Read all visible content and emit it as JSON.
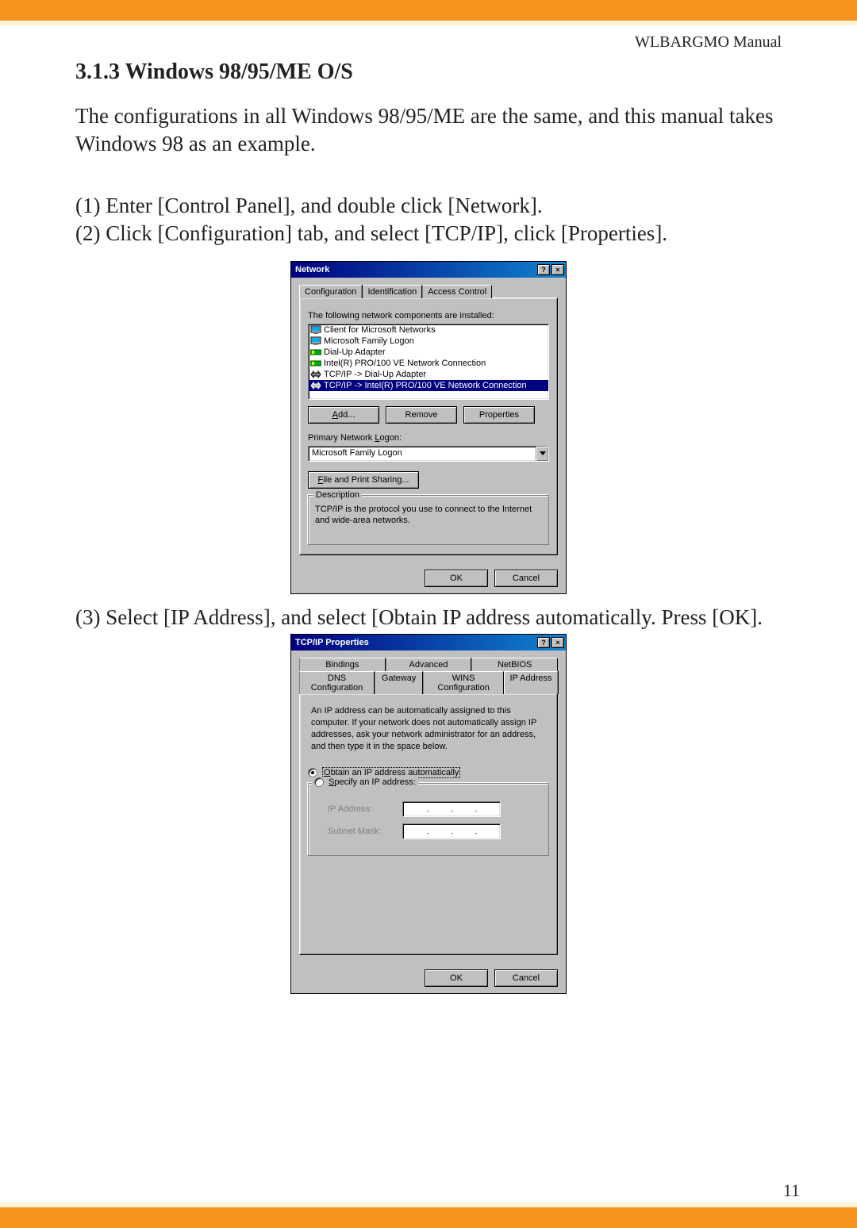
{
  "header": {
    "manual": "WLBARGMO Manual"
  },
  "section": {
    "heading": "3.1.3 Windows 98/95/ME O/S"
  },
  "para1": "The configurations in all Windows 98/95/ME are the same, and this manual takes Windows 98 as an example.",
  "steps": {
    "s1": "(1) Enter [Control Panel], and double click [Network].",
    "s2": "(2) Click [Configuration] tab, and select [TCP/IP], click [Properties].",
    "s3": "(3) Select [IP Address], and select [Obtain IP address automatically. Press [OK]."
  },
  "net_dialog": {
    "title": "Network",
    "tabs": {
      "t1": "Configuration",
      "t2": "Identification",
      "t3": "Access Control"
    },
    "list_label": "The following network components are installed:",
    "items": {
      "i0": "Client for Microsoft Networks",
      "i1": "Microsoft Family Logon",
      "i2": "Dial-Up Adapter",
      "i3": "Intel(R) PRO/100 VE Network Connection",
      "i4": "TCP/IP -> Dial-Up Adapter",
      "i5": "TCP/IP -> Intel(R) PRO/100 VE Network Connection"
    },
    "btn": {
      "add": "Add...",
      "remove": "Remove",
      "props": "Properties"
    },
    "primary_label": "Primary Network Logon:",
    "primary_value": "Microsoft Family Logon",
    "fps": "File and Print Sharing...",
    "desc": {
      "legend": "Description",
      "text": "TCP/IP is the protocol you use to connect to the Internet and wide-area networks."
    },
    "ok": "OK",
    "cancel": "Cancel"
  },
  "tcp_dialog": {
    "title": "TCP/IP Properties",
    "tabs_top": {
      "t1": "Bindings",
      "t2": "Advanced",
      "t3": "NetBIOS"
    },
    "tabs_bot": {
      "t1": "DNS Configuration",
      "t2": "Gateway",
      "t3": "WINS Configuration",
      "t4": "IP Address"
    },
    "intro": "An IP address can be automatically assigned to this computer. If your network does not automatically assign IP addresses, ask your network administrator for an address, and then type it in the space below.",
    "radio": {
      "auto": "Obtain an IP address automatically",
      "spec": "Specify an IP address:"
    },
    "fields": {
      "ip": "IP Address:",
      "mask": "Subnet Mask:"
    },
    "ok": "OK",
    "cancel": "Cancel"
  },
  "page_number": "11"
}
